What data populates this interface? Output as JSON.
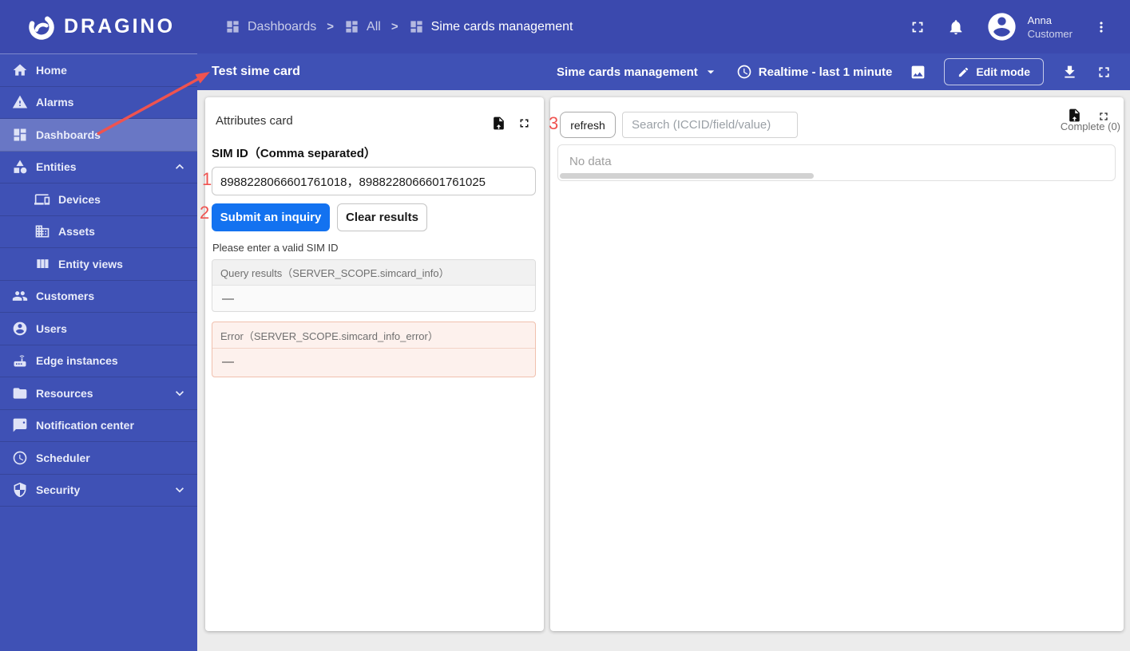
{
  "header": {
    "brand": "DRAGINO",
    "breadcrumb": {
      "separator": ">",
      "items": [
        "Dashboards",
        "All",
        "Sime cards management"
      ]
    },
    "user": {
      "name": "Anna",
      "role": "Customer"
    }
  },
  "sidebar": {
    "items": [
      {
        "label": "Home"
      },
      {
        "label": "Alarms"
      },
      {
        "label": "Dashboards",
        "active": true
      },
      {
        "label": "Entities",
        "expanded": true
      },
      {
        "label": "Devices",
        "sub": true
      },
      {
        "label": "Assets",
        "sub": true
      },
      {
        "label": "Entity views",
        "sub": true
      },
      {
        "label": "Customers"
      },
      {
        "label": "Users"
      },
      {
        "label": "Edge instances"
      },
      {
        "label": "Resources",
        "collapsed": true
      },
      {
        "label": "Notification center"
      },
      {
        "label": "Scheduler"
      },
      {
        "label": "Security",
        "collapsed": true
      }
    ]
  },
  "toolbar": {
    "page_title": "Test sime card",
    "dashboard_select": "Sime cards management",
    "timewindow": "Realtime - last 1 minute",
    "edit_mode_label": "Edit mode"
  },
  "attributes_card": {
    "title": "Attributes card",
    "sim_label": "SIM ID（Comma separated）",
    "sim_value": "8988228066601761018，8988228066601761025",
    "submit_label": "Submit an inquiry",
    "clear_label": "Clear results",
    "hint": "Please enter a valid SIM ID",
    "query_results_header": "Query results（SERVER_SCOPE.simcard_info）",
    "query_results_value": "—",
    "error_header": "Error（SERVER_SCOPE.simcard_info_error）",
    "error_value": "—"
  },
  "results_card": {
    "refresh_label": "refresh",
    "search_placeholder": "Search (ICCID/field/value)",
    "status": "Complete (0)",
    "empty_text": "No data"
  },
  "annotations": {
    "step1": "1",
    "step2": "2",
    "step3": "3"
  },
  "icons": {
    "dragino-swirl-icon": "spiral-ring",
    "dashboard-icon": "grid",
    "home-icon": "house",
    "alarms-icon": "warning-triangle",
    "entities-icon": "category-shapes",
    "devices-icon": "devices",
    "assets-icon": "building",
    "entity-views-icon": "columns",
    "customers-icon": "people",
    "users-icon": "person-circle",
    "edge-instances-icon": "router",
    "resources-icon": "folder",
    "notification-center-icon": "chat-bubble",
    "scheduler-icon": "clock",
    "security-icon": "shield",
    "chevron-up-icon": "^",
    "chevron-down-icon": "v",
    "fullscreen-icon": "⛶",
    "bell-icon": "🔔",
    "kebab-icon": "⋮",
    "caret-down-icon": "▾",
    "clock-icon": "🕐",
    "screenshot-icon": "image-frame",
    "pencil-icon": "✏",
    "download-icon": "⬇",
    "export-file-icon": "file",
    "avatar-icon": "person"
  },
  "colors": {
    "header_bg": "#3b49ae",
    "primary": "#3f51b5",
    "active_item": "rgba(255,255,255,0.22)",
    "submit_button": "#1372f0",
    "annotation_red": "#ef5350",
    "content_bg": "#ececec",
    "error_bg": "#fdf1ed",
    "error_border": "#f0c0ae"
  }
}
